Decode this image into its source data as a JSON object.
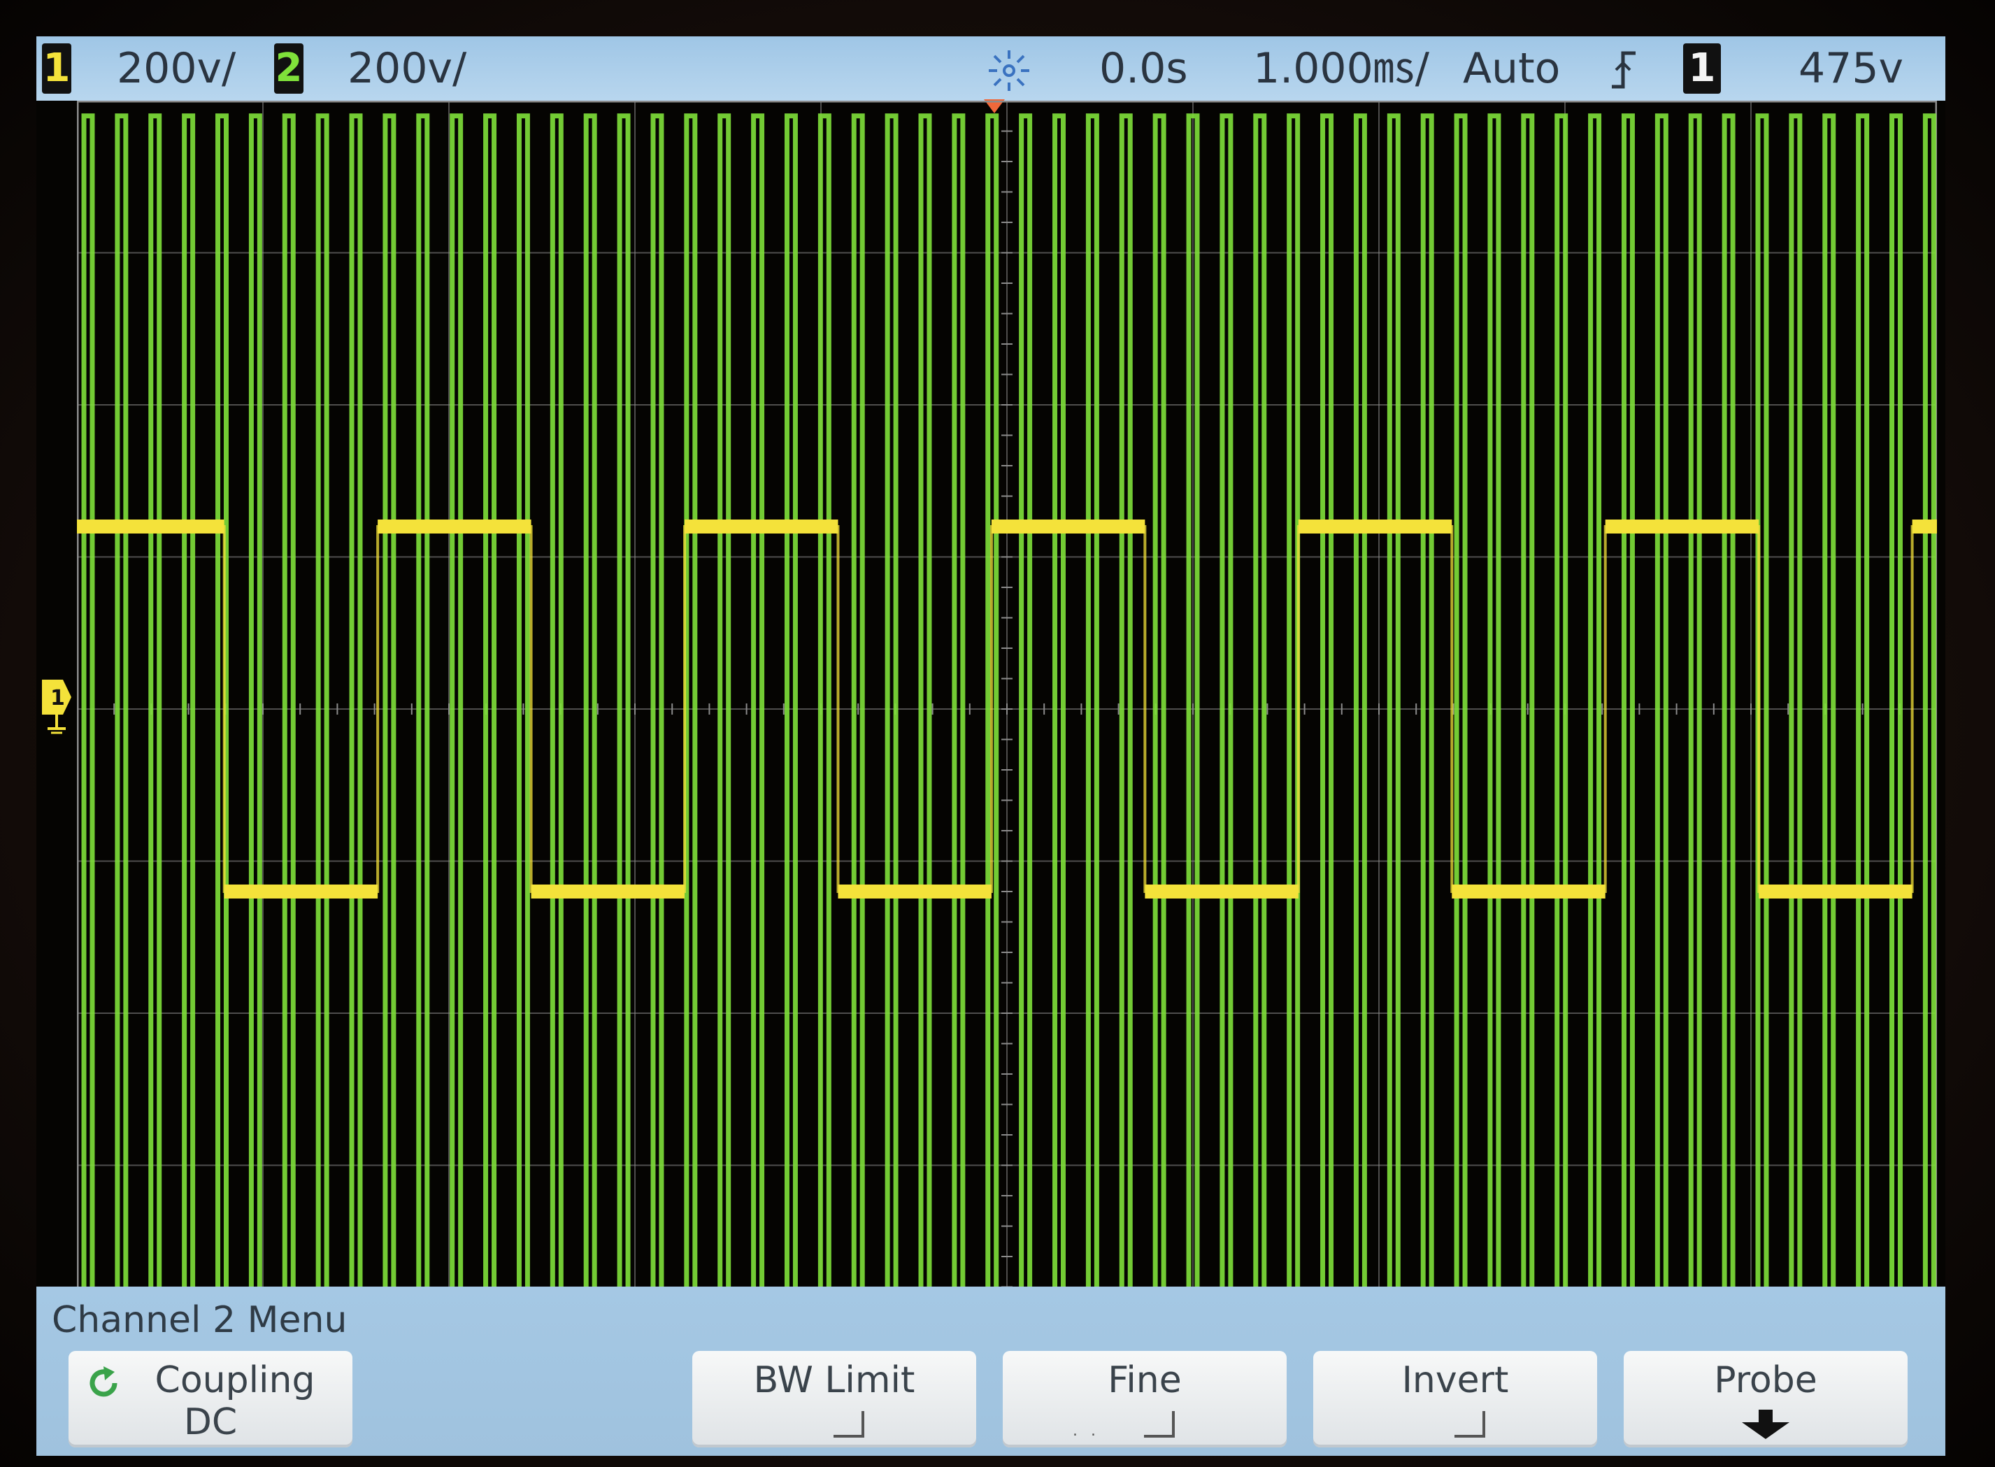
{
  "status": {
    "ch1_badge": "1",
    "ch1_scale": "200ⅴ/",
    "ch2_badge": "2",
    "ch2_scale": "200ⅴ/",
    "acquire_icon": "sun-burst-run-icon",
    "delay": "0.0s",
    "timebase": "1.000㎳/",
    "trigger_mode": "Auto",
    "slope_icon": "rising-edge-icon",
    "trigger_source_badge": "1",
    "trigger_level": "475ⅴ"
  },
  "colors": {
    "ch1": "#f4e23a",
    "ch2": "#7fe13a",
    "grid": "#8c8c8c",
    "menu_bg": "#a5c8e4",
    "status_bg": "#b8d6ee"
  },
  "menu": {
    "title": "Channel 2  Menu",
    "softkeys": [
      {
        "label": "Coupling",
        "value": "DC",
        "icon": "cycle-arrow-icon"
      },
      {
        "label": "BW Limit",
        "value": ""
      },
      {
        "label": "Fine",
        "value": ""
      },
      {
        "label": "Invert",
        "value": ""
      },
      {
        "label": "Probe",
        "value": "",
        "icon": "down-arrow-icon"
      }
    ]
  },
  "chart_data": {
    "type": "line",
    "title": "",
    "grid": true,
    "divisions": {
      "x": 10,
      "y": 8
    },
    "series": [
      {
        "channel": "1",
        "waveform": "square",
        "volts_per_div": "200ⅴ",
        "high_div": 1.2,
        "low_div": -1.2,
        "period_div": 1.65,
        "duty": 0.5,
        "color": "#f4e23a"
      },
      {
        "channel": "2",
        "waveform": "pulse train",
        "volts_per_div": "200ⅴ",
        "high_div": 3.9,
        "low_div": -3.9,
        "period_div": 0.18,
        "color": "#7fe13a"
      }
    ]
  }
}
